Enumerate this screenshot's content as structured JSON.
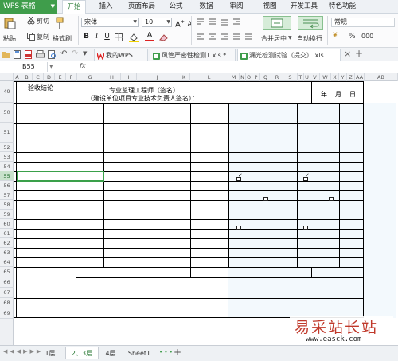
{
  "app": {
    "name": "WPS 表格"
  },
  "menu": [
    "开始",
    "插入",
    "页面布局",
    "公式",
    "数据",
    "审阅",
    "视图",
    "开发工具",
    "特色功能"
  ],
  "ribbon": {
    "cut": "剪切",
    "copy": "复制",
    "paste": "粘贴",
    "format_painter": "格式刷",
    "font_name": "宋体",
    "font_size": "10",
    "merge_center": "合并居中",
    "wrap_text": "自动换行",
    "number_format": "常规",
    "percent": "%",
    "thousands": "000"
  },
  "doc_tabs": [
    {
      "label": "我的WPS",
      "active": false
    },
    {
      "label": "风管严密性检测1.xls *",
      "active": false
    },
    {
      "label": "漏光检测试验（提交）.xls",
      "active": true
    }
  ],
  "formula_bar": {
    "cell_ref": "B55",
    "fx": "fx"
  },
  "columns": [
    "A",
    "B",
    "C",
    "D",
    "E",
    "F",
    "G",
    "H",
    "I",
    "J",
    "K",
    "L",
    "M",
    "N",
    "O",
    "P",
    "Q",
    "R",
    "S",
    "T",
    "U",
    "V",
    "W",
    "X",
    "Y",
    "Z",
    "AA",
    "AB"
  ],
  "rows": [
    "49",
    "50",
    "51",
    "52",
    "53",
    "54",
    "55",
    "56",
    "57",
    "58",
    "59",
    "60",
    "61",
    "62",
    "63",
    "64",
    "65",
    "66",
    "67",
    "68",
    "69"
  ],
  "sheet": {
    "acceptance_label": "验收结论",
    "supervisor_line1": "专业监理工程师（签名）",
    "supervisor_line2": "（建设单位项目专业技术负责人签名）：",
    "year": "年",
    "month": "月",
    "day": "日"
  },
  "sheet_tabs": [
    {
      "label": "1层",
      "active": false
    },
    {
      "label": "2、3层",
      "active": true
    },
    {
      "label": "4层",
      "active": false
    },
    {
      "label": "Sheet1",
      "active": false
    }
  ],
  "sheet_more": "• • •",
  "add_sheet": "+",
  "watermark": {
    "cn": "易采站长站",
    "url": "www.easck.com"
  },
  "colors": {
    "accent": "#3f9d4b",
    "selected": "#3aa04a"
  }
}
